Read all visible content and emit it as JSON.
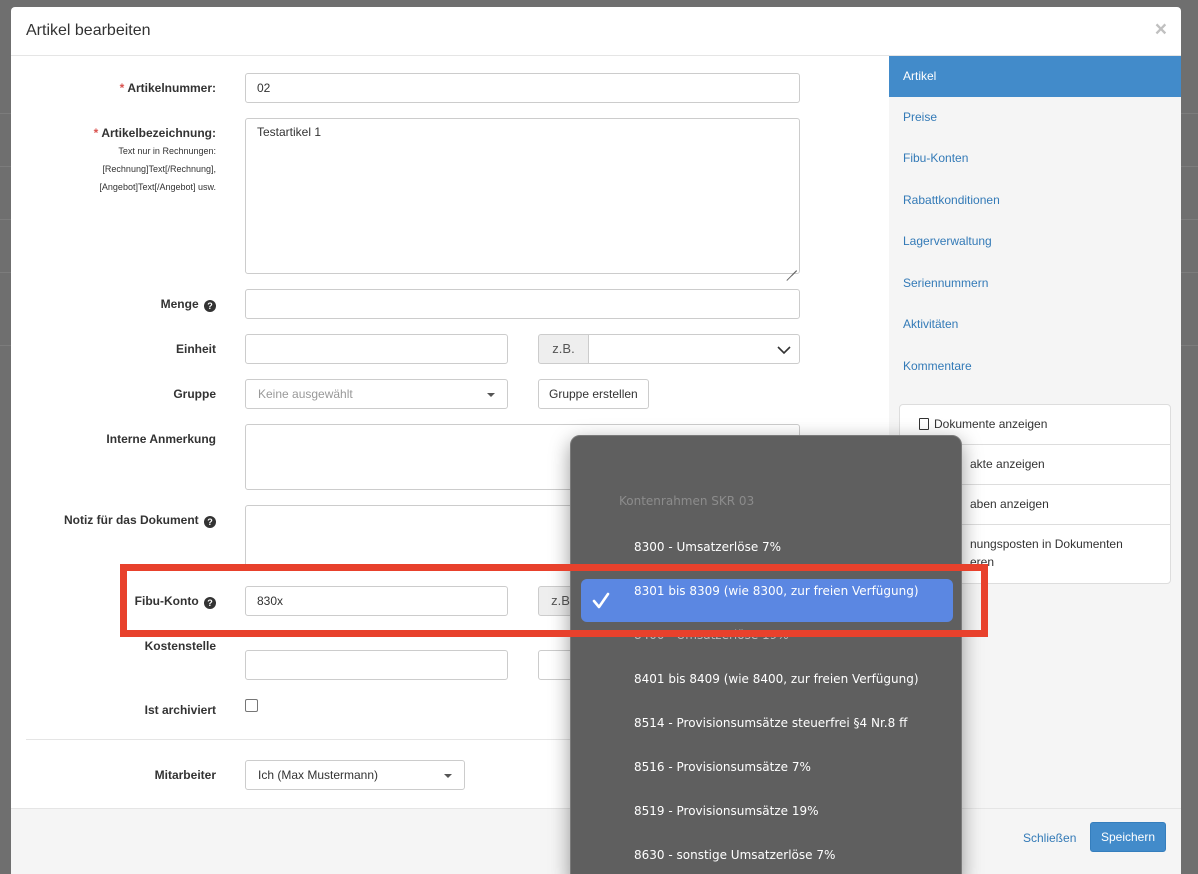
{
  "modal": {
    "title": "Artikel bearbeiten",
    "close_glyph": "×"
  },
  "form": {
    "artikelnummer": {
      "label": "Artikelnummer:",
      "required": "*",
      "value": "02"
    },
    "artikelbezeichnung": {
      "label": "Artikelbezeichnung:",
      "required": "*",
      "value": "Testartikel 1",
      "hint": [
        "Text nur in Rechnungen:",
        "[Rechnung]Text[/Rechnung],",
        "[Angebot]Text[/Angebot] usw."
      ]
    },
    "menge": {
      "label": "Menge",
      "value": ""
    },
    "einheit": {
      "label": "Einheit",
      "value": "",
      "addon": "z.B.",
      "select_value": ""
    },
    "gruppe": {
      "label": "Gruppe",
      "placeholder": "Keine ausgewählt",
      "create_button": "Gruppe erstellen"
    },
    "interne_anmerkung": {
      "label": "Interne Anmerkung",
      "value": ""
    },
    "notiz": {
      "label": "Notiz für das Dokument",
      "value": ""
    },
    "fibu_konto": {
      "label": "Fibu-Konto",
      "value": "830x",
      "addon": "z.B"
    },
    "kostenstelle": {
      "label": "Kostenstelle",
      "value": ""
    },
    "archiviert": {
      "label": "Ist archiviert",
      "checked": false
    },
    "mitarbeiter": {
      "label": "Mitarbeiter",
      "value": "Ich (Max Mustermann)"
    }
  },
  "sidebar": {
    "nav": [
      "Artikel",
      "Preise",
      "Fibu-Konten",
      "Rabattkonditionen",
      "Lagerverwaltung",
      "Seriennummern",
      "Aktivitäten",
      "Kommentare"
    ],
    "active_index": 0,
    "actions": [
      "Dokumente anzeigen",
      "akte anzeigen",
      "aben anzeigen",
      "nungsposten in Dokumenten",
      "eren"
    ]
  },
  "footer": {
    "close_label": "Schließen",
    "save_label": "Speichern"
  },
  "dropdown": {
    "group_label": "Kontenrahmen SKR 03",
    "items": [
      "8300 - Umsatzerlöse 7%",
      "8301 bis 8309 (wie 8300, zur freien Verfügung)",
      "8400 - Umsatzerlöse 19%",
      "8401 bis 8409 (wie 8400, zur freien Verfügung)",
      "8514 - Provisionsumsätze steuerfrei §4 Nr.8 ff",
      "8516 - Provisionsumsätze 7%",
      "8519 - Provisionsumsätze 19%",
      "8630 - sonstige Umsatzerlöse 7%"
    ],
    "selected_index": 1
  },
  "colors": {
    "accent": "#428bca",
    "highlight": "#e8412c",
    "selection": "#5b87e2"
  }
}
